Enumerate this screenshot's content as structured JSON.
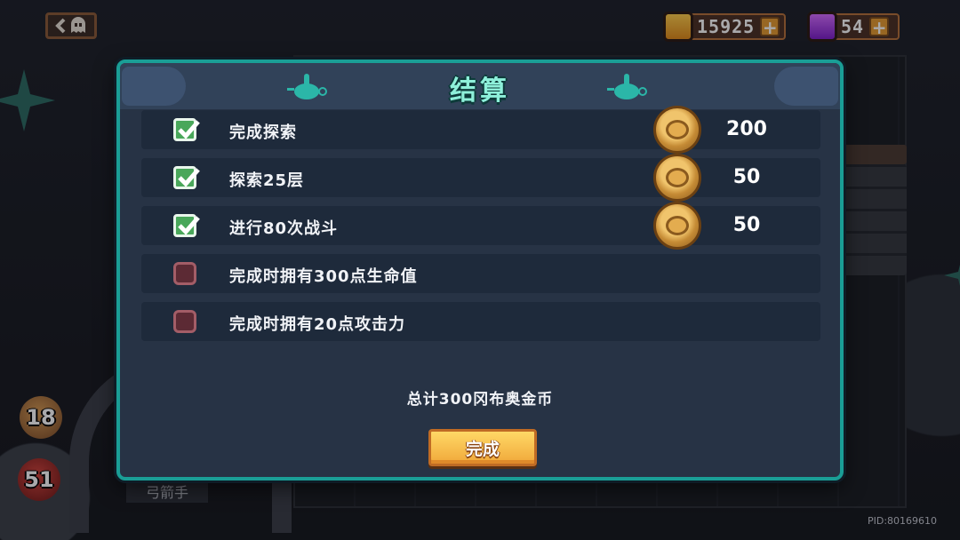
{
  "topbar": {
    "gold": {
      "value": "15925",
      "icon": "gold-coin-icon",
      "color": "#ffb22e"
    },
    "gems": {
      "value": "54",
      "icon": "purple-gem-icon",
      "color": "#b84af0"
    },
    "plus_label": "+"
  },
  "side": {
    "attack": "18",
    "hp": "51",
    "character_name": "弓箭手"
  },
  "pid": "PID:80169610",
  "modal": {
    "title": "结算",
    "tasks": [
      {
        "label": "完成探索",
        "completed": true,
        "reward": "200"
      },
      {
        "label": "探索25层",
        "completed": true,
        "reward": "50"
      },
      {
        "label": "进行80次战斗",
        "completed": true,
        "reward": "50"
      },
      {
        "label": "完成时拥有300点生命值",
        "completed": false,
        "reward": ""
      },
      {
        "label": "完成时拥有20点攻击力",
        "completed": false,
        "reward": ""
      }
    ],
    "total": "总计300冈布奥金币",
    "confirm_label": "完成"
  },
  "colors": {
    "accent": "#1a9e96",
    "title": "#8ef0da",
    "button": "#f0a83a"
  }
}
